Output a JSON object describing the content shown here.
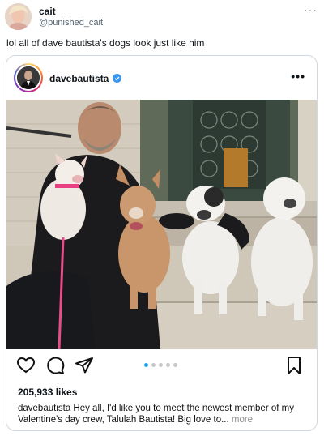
{
  "tweet": {
    "display_name": "cait",
    "handle": "@punished_cait",
    "more_icon": "···",
    "text": "lol all of dave bautista's dogs look just like him"
  },
  "instagram_post": {
    "username": "davebautista",
    "verified": true,
    "more_icon": "•••",
    "likes": "205,933 likes",
    "caption_user": "davebautista",
    "caption_text": " Hey all, I'd like you to meet the newest member of my Valentine's day crew, Talulah Bautista! Big love to...",
    "caption_more": " more",
    "carousel_total": 5,
    "carousel_active": 1,
    "icons": [
      "heart-icon",
      "comment-icon",
      "share-icon",
      "bookmark-icon",
      "user-tag-icon"
    ],
    "accent_color": "#1da1f2"
  }
}
